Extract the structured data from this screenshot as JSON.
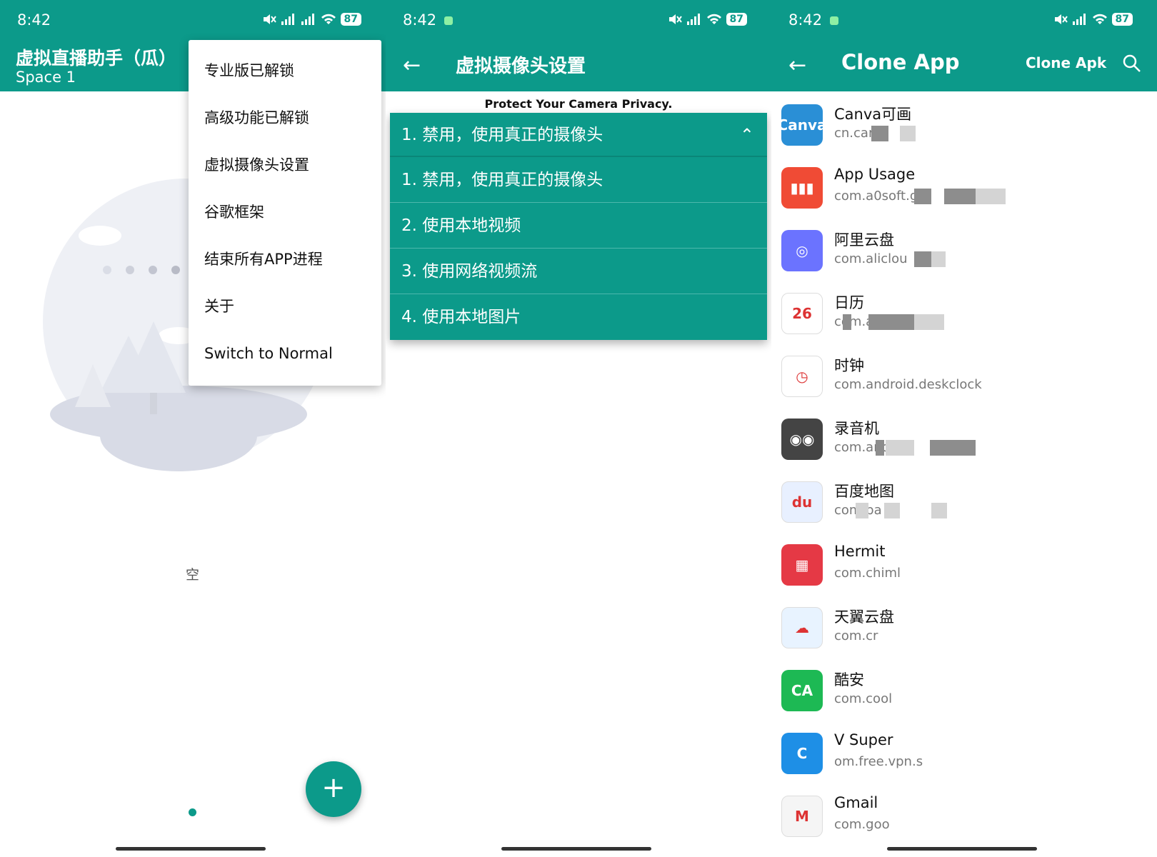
{
  "status": {
    "time": "8:42",
    "battery": "87"
  },
  "panel1": {
    "title": "虚拟直播助手（瓜）",
    "subtitle": "Space 1",
    "menu": [
      "专业版已解锁",
      "高级功能已解锁",
      "虚拟摄像头设置",
      "谷歌框架",
      "结束所有APP进程",
      "关于",
      "Switch to Normal"
    ],
    "empty_text": "空",
    "fab_label": "+"
  },
  "panel2": {
    "back": "←",
    "title": "虚拟摄像头设置",
    "privacy": "Protect Your Camera Privacy.",
    "selected": "1. 禁用，使用真正的摄像头",
    "chevron": "⌃",
    "options": [
      "1. 禁用，使用真正的摄像头",
      "2. 使用本地视频",
      "3. 使用网络视频流",
      "4. 使用本地图片"
    ]
  },
  "panel3": {
    "back": "←",
    "title": "Clone App",
    "clone_apk": "Clone Apk",
    "search_icon": "search-icon",
    "apps": [
      {
        "name": "Canva可画",
        "pkg": "cn.car",
        "icon_text": "Canva",
        "color": "#2a8fd6"
      },
      {
        "name": "App Usage",
        "pkg": "com.a0soft.g",
        "icon_text": "▮▮▮",
        "color": "#f04b35"
      },
      {
        "name": "阿里云盘",
        "pkg": "com.aliclou",
        "icon_text": "◎",
        "color": "#6b73ff"
      },
      {
        "name": "日历",
        "pkg": "com.a",
        "icon_text": "26",
        "color": "#ffffff"
      },
      {
        "name": "时钟",
        "pkg": "com.android.deskclock",
        "icon_text": "◷",
        "color": "#ffffff"
      },
      {
        "name": "录音机",
        "pkg": "com.andro",
        "icon_text": "◉◉",
        "color": "#444444"
      },
      {
        "name": "百度地图",
        "pkg": "com.ba",
        "icon_text": "du",
        "color": "#e8f0ff"
      },
      {
        "name": "Hermit",
        "pkg": "com.chiml",
        "icon_text": "▦",
        "color": "#e53945"
      },
      {
        "name": "天翼云盘",
        "pkg": "com.cr",
        "icon_text": "☁",
        "color": "#e8f3ff"
      },
      {
        "name": "酷安",
        "pkg": "com.cool",
        "icon_text": "CA",
        "color": "#1db954"
      },
      {
        "name": "V Super",
        "pkg": "om.free.vpn.s",
        "icon_text": "C",
        "color": "#1e8fe6"
      },
      {
        "name": "Gmail",
        "pkg": "com.goo",
        "icon_text": "M",
        "color": "#f5f5f5"
      }
    ]
  }
}
